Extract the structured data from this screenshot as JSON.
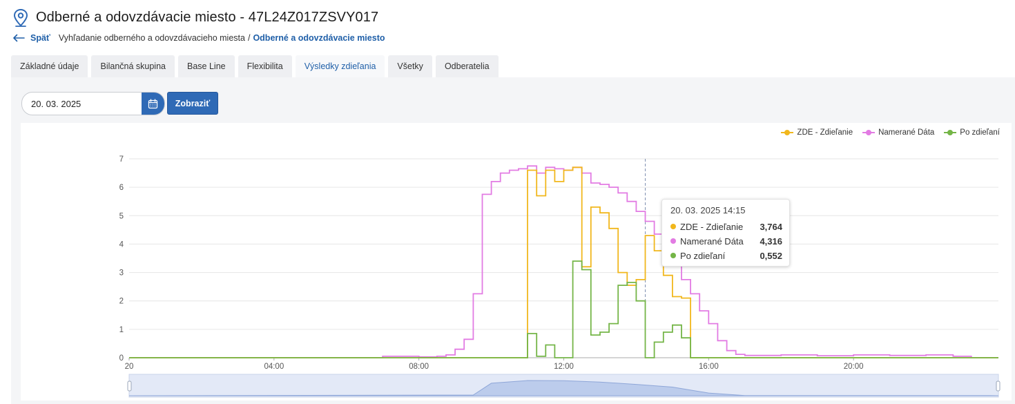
{
  "page": {
    "title": "Odberné a odovzdávacie miesto - 47L24Z017ZSVY017",
    "back_label": "Späť",
    "breadcrumb_prev": "Vyhľadanie odberného a odovzdávacieho miesta",
    "breadcrumb_sep": "/",
    "breadcrumb_current": "Odberné a odovzdávacie miesto"
  },
  "tabs": [
    {
      "label": "Základné údaje"
    },
    {
      "label": "Bilančná skupina"
    },
    {
      "label": "Base Line"
    },
    {
      "label": "Flexibilita"
    },
    {
      "label": "Výsledky zdieľania",
      "active": true
    },
    {
      "label": "Všetky"
    },
    {
      "label": "Odberatelia"
    }
  ],
  "filter": {
    "date_value": "20. 03. 2025",
    "show_label": "Zobraziť"
  },
  "tooltip": {
    "title": "20. 03. 2025 14:15",
    "rows": [
      {
        "name": "ZDE - Zdieľanie",
        "value": "3,764",
        "color": "#f1b71c"
      },
      {
        "name": "Namerané Dáta",
        "value": "4,316",
        "color": "#e27be3"
      },
      {
        "name": "Po zdieľaní",
        "value": "0,552",
        "color": "#74b547"
      }
    ]
  },
  "chart_data": {
    "type": "line",
    "step": true,
    "interval_minutes": 15,
    "x": {
      "start": "00:00",
      "end": "23:45",
      "tick_labels": [
        "20",
        "04:00",
        "08:00",
        "12:00",
        "16:00",
        "20:00"
      ]
    },
    "ylim": [
      0,
      7
    ],
    "y_ticks": [
      "0",
      "1",
      "2",
      "3",
      "4",
      "5",
      "6",
      "7"
    ],
    "grid": true,
    "legend_position": "top-right",
    "cursor_time": "14:15",
    "has_zoom_slider": true,
    "series": [
      {
        "name": "ZDE - Zdieľanie",
        "color": "#f1b71c",
        "points": [
          [
            "00:00",
            0
          ],
          [
            "07:00",
            0
          ],
          [
            "11:00",
            6.6
          ],
          [
            "11:15",
            5.7
          ],
          [
            "11:30",
            6.6
          ],
          [
            "11:45",
            6.2
          ],
          [
            "12:00",
            6.6
          ],
          [
            "12:15",
            6.7
          ],
          [
            "12:30",
            3.2
          ],
          [
            "12:45",
            5.3
          ],
          [
            "13:00",
            5.1
          ],
          [
            "13:15",
            4.55
          ],
          [
            "13:30",
            3.0
          ],
          [
            "13:45",
            2.55
          ],
          [
            "14:00",
            2.75
          ],
          [
            "14:15",
            4.3
          ],
          [
            "14:30",
            3.764
          ],
          [
            "14:45",
            2.9
          ],
          [
            "15:00",
            2.15
          ],
          [
            "15:15",
            2.1
          ],
          [
            "15:30",
            0
          ],
          [
            "23:45",
            0
          ]
        ]
      },
      {
        "name": "Namerané Dáta",
        "color": "#e27be3",
        "points": [
          [
            "00:00",
            0
          ],
          [
            "07:00",
            0.05
          ],
          [
            "07:30",
            0.05
          ],
          [
            "08:00",
            0.03
          ],
          [
            "08:30",
            0.05
          ],
          [
            "08:45",
            0.1
          ],
          [
            "09:00",
            0.3
          ],
          [
            "09:15",
            0.65
          ],
          [
            "09:30",
            2.25
          ],
          [
            "09:45",
            5.75
          ],
          [
            "10:00",
            6.2
          ],
          [
            "10:15",
            6.5
          ],
          [
            "10:30",
            6.6
          ],
          [
            "10:45",
            6.65
          ],
          [
            "11:00",
            6.75
          ],
          [
            "11:15",
            6.5
          ],
          [
            "11:30",
            6.7
          ],
          [
            "11:45",
            6.65
          ],
          [
            "12:00",
            6.6
          ],
          [
            "12:15",
            6.7
          ],
          [
            "12:30",
            6.5
          ],
          [
            "12:45",
            6.15
          ],
          [
            "13:00",
            6.1
          ],
          [
            "13:15",
            6.0
          ],
          [
            "13:30",
            5.8
          ],
          [
            "13:45",
            5.5
          ],
          [
            "14:00",
            5.15
          ],
          [
            "14:15",
            4.8
          ],
          [
            "14:30",
            4.35
          ],
          [
            "14:45",
            4.316
          ],
          [
            "15:00",
            3.8
          ],
          [
            "15:15",
            2.75
          ],
          [
            "15:30",
            2.25
          ],
          [
            "15:45",
            1.65
          ],
          [
            "16:00",
            1.2
          ],
          [
            "16:15",
            0.6
          ],
          [
            "16:30",
            0.25
          ],
          [
            "16:45",
            0.12
          ],
          [
            "17:00",
            0.08
          ],
          [
            "18:00",
            0.1
          ],
          [
            "19:00",
            0.07
          ],
          [
            "20:00",
            0.1
          ],
          [
            "21:00",
            0.08
          ],
          [
            "22:00",
            0.1
          ],
          [
            "22:45",
            0.05
          ],
          [
            "23:00",
            0.05
          ],
          [
            "23:15",
            0
          ]
        ]
      },
      {
        "name": "Po zdieľaní",
        "color": "#74b547",
        "points": [
          [
            "00:00",
            0
          ],
          [
            "11:00",
            0.85
          ],
          [
            "11:15",
            0.05
          ],
          [
            "11:30",
            0.45
          ],
          [
            "11:45",
            0
          ],
          [
            "12:15",
            3.4
          ],
          [
            "12:30",
            3.1
          ],
          [
            "12:45",
            0.8
          ],
          [
            "13:00",
            0.9
          ],
          [
            "13:15",
            1.2
          ],
          [
            "13:30",
            2.55
          ],
          [
            "13:45",
            2.65
          ],
          [
            "14:00",
            2.0
          ],
          [
            "14:15",
            0
          ],
          [
            "14:30",
            0.55
          ],
          [
            "14:45",
            0.9
          ],
          [
            "15:00",
            1.15
          ],
          [
            "15:15",
            0.7
          ],
          [
            "15:30",
            0
          ],
          [
            "23:45",
            0
          ]
        ]
      }
    ],
    "overview": [
      [
        "00:00",
        0
      ],
      [
        "09:30",
        0.3
      ],
      [
        "10:00",
        5.5
      ],
      [
        "11:00",
        6.7
      ],
      [
        "12:00",
        6.6
      ],
      [
        "13:00",
        6.0
      ],
      [
        "14:00",
        5.0
      ],
      [
        "15:00",
        3.8
      ],
      [
        "16:00",
        1.2
      ],
      [
        "17:00",
        0.1
      ],
      [
        "23:45",
        0.05
      ]
    ]
  }
}
